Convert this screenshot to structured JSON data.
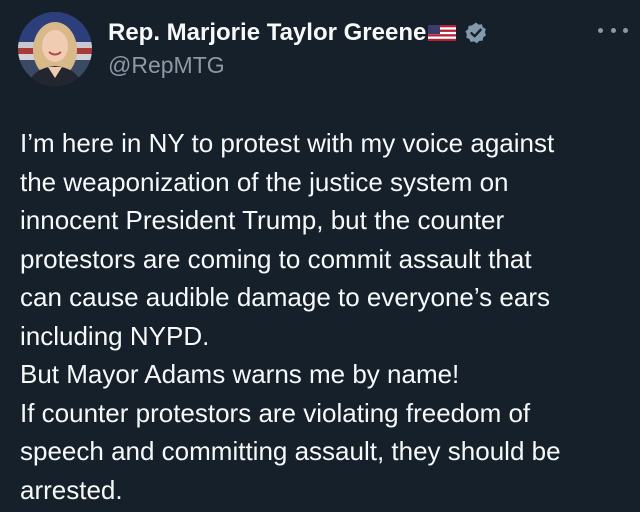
{
  "author": {
    "display_name": "Rep. Marjorie Taylor Greene",
    "handle": "@RepMTG",
    "flag_icon": "us-flag-icon",
    "verified_icon": "verified-badge-icon"
  },
  "more_menu": {
    "icon": "more-options-icon"
  },
  "tweet": {
    "lines": [
      "I’m here in NY to protest with my voice against",
      "the weaponization of the justice system on",
      "innocent President Trump, but the counter",
      "protestors are coming to commit assault that",
      "can cause audible damage to everyone’s ears",
      "including NYPD.",
      "But Mayor Adams warns me by name!",
      "If counter protestors are violating freedom of",
      "speech and committing assault, they should be",
      "arrested."
    ]
  },
  "colors": {
    "background": "#15202b",
    "text_primary": "#f7f9f9",
    "text_secondary": "#8b98a5",
    "verified_badge": "#829aab"
  }
}
